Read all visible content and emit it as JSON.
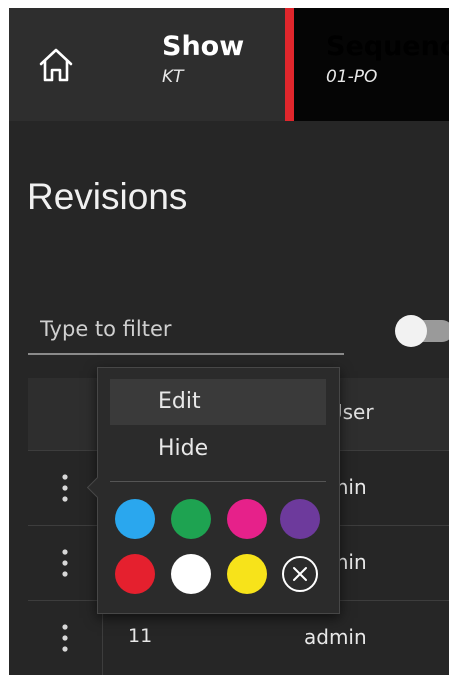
{
  "breadcrumb": {
    "show": {
      "label": "Show",
      "value": "KT"
    },
    "sequence": {
      "label": "Sequence",
      "value": "01-PO"
    }
  },
  "page": {
    "title": "Revisions"
  },
  "filter": {
    "placeholder": "Type to filter",
    "toggle_on": false
  },
  "table": {
    "columns": [
      "",
      "",
      "User"
    ],
    "rows": [
      {
        "number": "",
        "user": "admin"
      },
      {
        "number": "",
        "user": "admin"
      },
      {
        "number": "11",
        "user": "admin"
      }
    ]
  },
  "context_menu": {
    "items": [
      {
        "label": "Edit",
        "highlighted": true
      },
      {
        "label": "Hide",
        "highlighted": false
      }
    ],
    "colors": [
      "#2aa7ee",
      "#1ea351",
      "#e6218a",
      "#6d3a9c",
      "#e5202e",
      "#ffffff",
      "#f7e31a"
    ],
    "clear_icon": "circle-x-icon"
  },
  "icons": {
    "home": "home-icon",
    "kebab": "kebab-menu-icon"
  }
}
